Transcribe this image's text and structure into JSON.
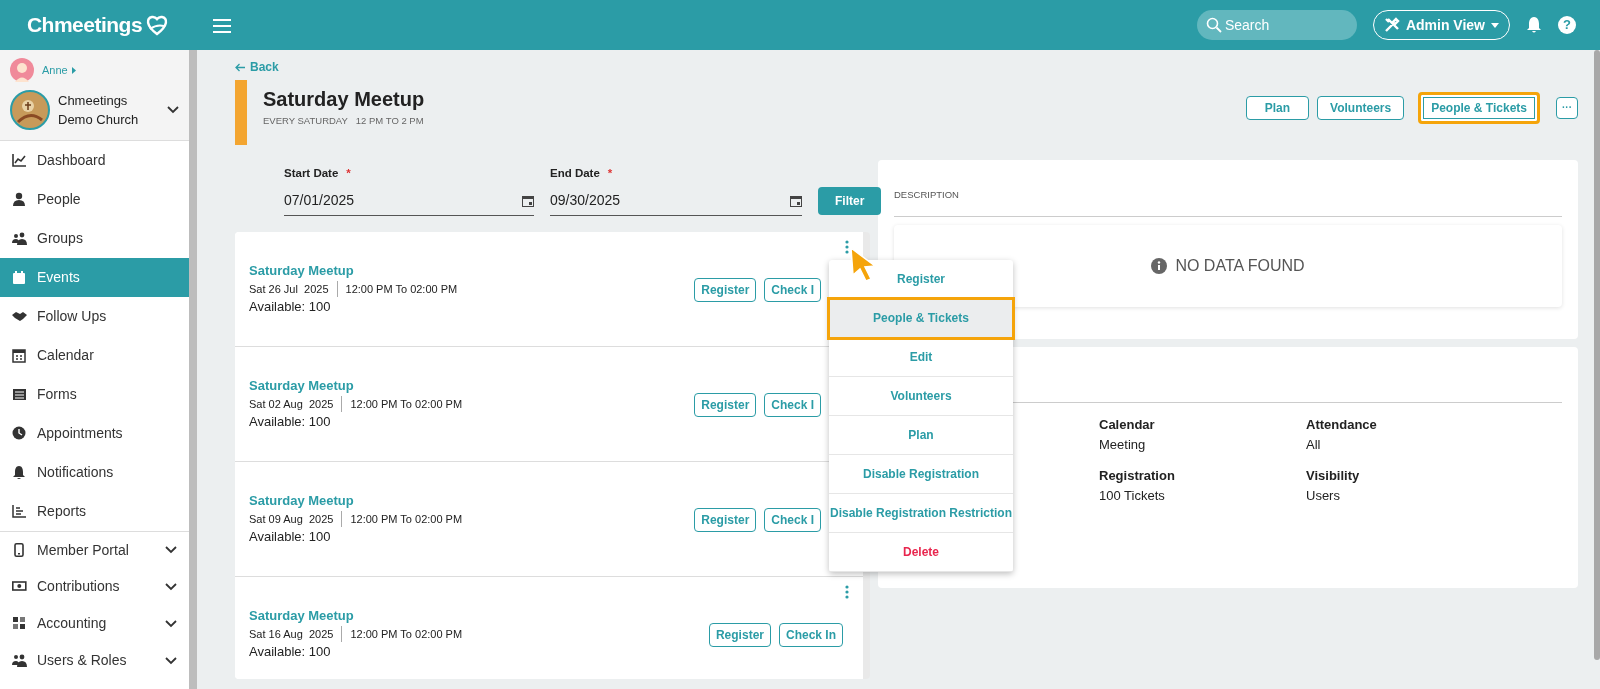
{
  "topbar": {
    "brand": "Chmeetings",
    "search": {
      "placeholder": "Search"
    },
    "view_button": "Admin View",
    "help_label": "?"
  },
  "user": {
    "name": "Anne"
  },
  "church": {
    "name": "Chmeetings Demo Church"
  },
  "sidebar": {
    "items": [
      {
        "label": "Dashboard",
        "selected": false,
        "kind": "link"
      },
      {
        "label": "People",
        "selected": false,
        "kind": "link"
      },
      {
        "label": "Groups",
        "selected": false,
        "kind": "link"
      },
      {
        "label": "Events",
        "selected": true,
        "kind": "link"
      },
      {
        "label": "Follow Ups",
        "selected": false,
        "kind": "link"
      },
      {
        "label": "Calendar",
        "selected": false,
        "kind": "link"
      },
      {
        "label": "Forms",
        "selected": false,
        "kind": "link"
      },
      {
        "label": "Appointments",
        "selected": false,
        "kind": "link"
      },
      {
        "label": "Notifications",
        "selected": false,
        "kind": "link"
      },
      {
        "label": "Reports",
        "selected": false,
        "kind": "link"
      },
      {
        "label": "Member Portal",
        "selected": false,
        "kind": "group"
      },
      {
        "label": "Contributions",
        "selected": false,
        "kind": "group"
      },
      {
        "label": "Accounting",
        "selected": false,
        "kind": "group"
      },
      {
        "label": "Users & Roles",
        "selected": false,
        "kind": "group"
      }
    ]
  },
  "page": {
    "back": "Back",
    "title": "Saturday Meetup",
    "subtitle_days": "EVERY SATURDAY",
    "subtitle_time": "12 PM TO 2 PM",
    "actions": [
      {
        "label": "Plan",
        "highlighted": false
      },
      {
        "label": "Volunteers",
        "highlighted": false
      },
      {
        "label": "People & Tickets",
        "highlighted": true
      }
    ],
    "more_label": "···"
  },
  "filters": {
    "start": {
      "label": "Start Date",
      "required": true,
      "value": "07/01/2025"
    },
    "end": {
      "label": "End Date",
      "required": true,
      "value": "09/30/2025"
    },
    "button": "Filter",
    "required_mark": "*"
  },
  "events": [
    {
      "title": "Saturday Meetup",
      "date": "Sat 26 Jul  2025",
      "time": "12:00 PM To 02:00 PM",
      "available": "Available: 100",
      "buttons": [
        "Register",
        "Check I"
      ],
      "kebab": true
    },
    {
      "title": "Saturday Meetup",
      "date": "Sat 02 Aug  2025",
      "time": "12:00 PM To 02:00 PM",
      "available": "Available: 100",
      "buttons": [
        "Register",
        "Check I"
      ],
      "kebab": false
    },
    {
      "title": "Saturday Meetup",
      "date": "Sat 09 Aug  2025",
      "time": "12:00 PM To 02:00 PM",
      "available": "Available: 100",
      "buttons": [
        "Register",
        "Check I"
      ],
      "kebab": false
    },
    {
      "title": "Saturday Meetup",
      "date": "Sat 16 Aug  2025",
      "time": "12:00 PM To 02:00 PM",
      "available": "Available: 100",
      "buttons": [
        "Register",
        "Check In"
      ],
      "kebab": true
    }
  ],
  "menu": {
    "items": [
      {
        "label": "Register",
        "selected": false,
        "kind": "normal"
      },
      {
        "label": "People & Tickets",
        "selected": true,
        "kind": "normal"
      },
      {
        "label": "Edit",
        "selected": false,
        "kind": "normal"
      },
      {
        "label": "Volunteers",
        "selected": false,
        "kind": "normal"
      },
      {
        "label": "Plan",
        "selected": false,
        "kind": "normal"
      },
      {
        "label": "Disable Registration",
        "selected": false,
        "kind": "normal"
      },
      {
        "label": "Disable Registration Restriction",
        "selected": false,
        "kind": "normal"
      },
      {
        "label": "Delete",
        "selected": false,
        "kind": "danger"
      }
    ]
  },
  "description": {
    "heading": "DESCRIPTION",
    "empty": "NO DATA FOUND"
  },
  "details": {
    "fields": [
      {
        "label": "Calendar",
        "value": "Meeting"
      },
      {
        "label": "Attendance",
        "value": "All"
      },
      {
        "label": "Registration",
        "value": "100 Tickets"
      },
      {
        "label": "Visibility",
        "value": "Users"
      }
    ]
  }
}
